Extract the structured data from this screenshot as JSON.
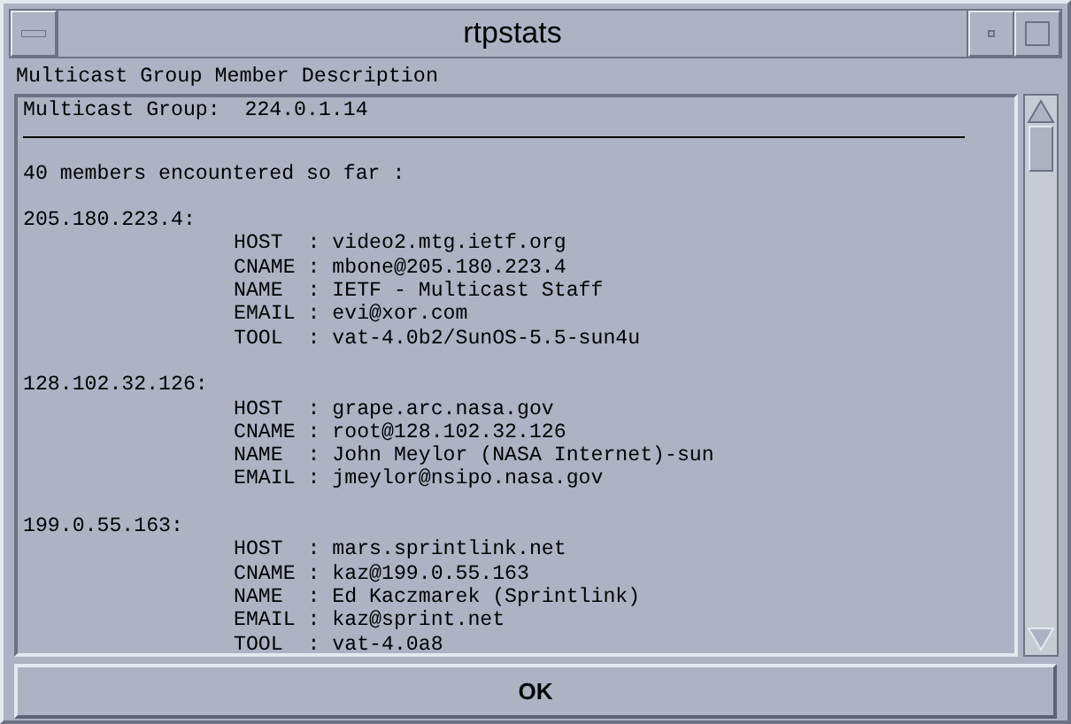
{
  "window": {
    "title": "rtpstats"
  },
  "label": "Multicast Group Member Description",
  "report": {
    "group_line": "Multicast Group:  224.0.1.14",
    "count_line": "40 members encountered so far :",
    "members": [
      {
        "address": "205.180.223.4:",
        "fields": [
          "HOST  : video2.mtg.ietf.org",
          "CNAME : mbone@205.180.223.4",
          "NAME  : IETF - Multicast Staff",
          "EMAIL : evi@xor.com",
          "TOOL  : vat-4.0b2/SunOS-5.5-sun4u"
        ]
      },
      {
        "address": "128.102.32.126:",
        "fields": [
          "HOST  : grape.arc.nasa.gov",
          "CNAME : root@128.102.32.126",
          "NAME  : John Meylor (NASA Internet)-sun",
          "EMAIL : jmeylor@nsipo.nasa.gov"
        ]
      },
      {
        "address": "199.0.55.163:",
        "fields": [
          "HOST  : mars.sprintlink.net",
          "CNAME : kaz@199.0.55.163",
          "NAME  : Ed Kaczmarek (Sprintlink)",
          "EMAIL : kaz@sprint.net",
          "TOOL  : vat-4.0a8"
        ]
      }
    ]
  },
  "buttons": [
    "OK"
  ]
}
